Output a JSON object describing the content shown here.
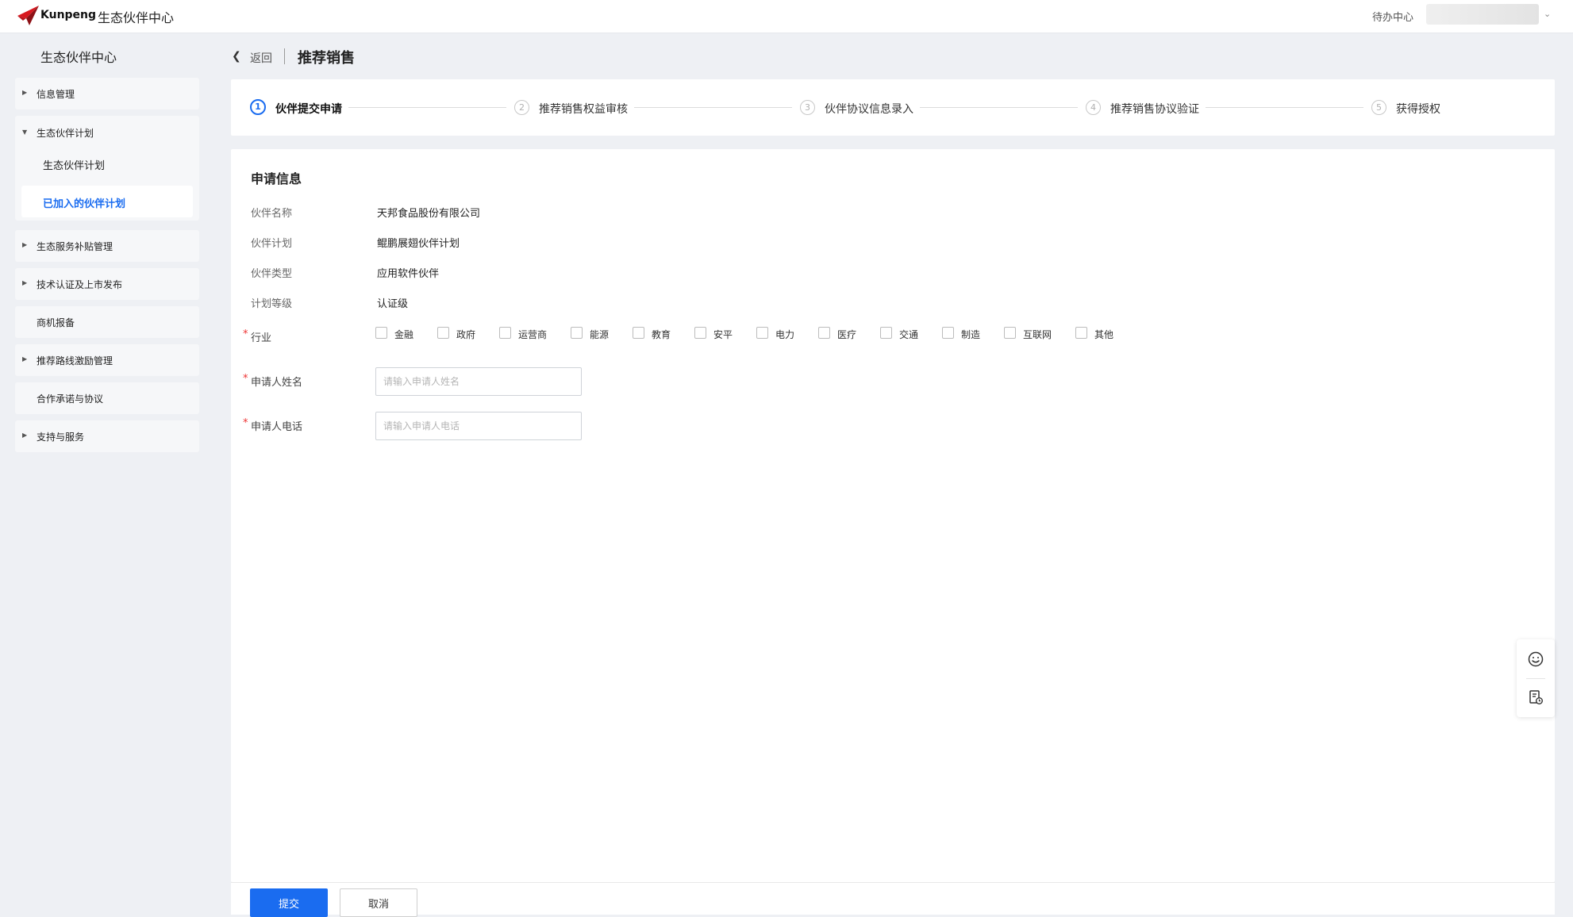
{
  "topbar": {
    "brand": "Kunpeng",
    "app_title": "生态伙伴中心",
    "todo_label": "待办中心"
  },
  "sidebar": {
    "title": "生态伙伴中心",
    "items": [
      {
        "label": "信息管理"
      },
      {
        "label": "生态伙伴计划",
        "children": [
          {
            "label": "生态伙伴计划"
          },
          {
            "label": "已加入的伙伴计划"
          }
        ]
      },
      {
        "label": "生态服务补贴管理"
      },
      {
        "label": "技术认证及上市发布"
      },
      {
        "label": "商机报备"
      },
      {
        "label": "推荐路线激励管理"
      },
      {
        "label": "合作承诺与协议"
      },
      {
        "label": "支持与服务"
      }
    ]
  },
  "header": {
    "back_label": "返回",
    "page_title": "推荐销售"
  },
  "steps": [
    {
      "num": "1",
      "label": "伙伴提交申请"
    },
    {
      "num": "2",
      "label": "推荐销售权益审核"
    },
    {
      "num": "3",
      "label": "伙伴协议信息录入"
    },
    {
      "num": "4",
      "label": "推荐销售协议验证"
    },
    {
      "num": "5",
      "label": "获得授权"
    }
  ],
  "form": {
    "section_title": "申请信息",
    "fields": [
      {
        "label": "伙伴名称",
        "value": "天邦食品股份有限公司"
      },
      {
        "label": "伙伴计划",
        "value": "鲲鹏展翅伙伴计划"
      },
      {
        "label": "伙伴类型",
        "value": "应用软件伙伴"
      },
      {
        "label": "计划等级",
        "value": "认证级"
      }
    ],
    "required_mark": "*",
    "industry_label": "行业",
    "industries": [
      "金融",
      "政府",
      "运营商",
      "能源",
      "教育",
      "安平",
      "电力",
      "医疗",
      "交通",
      "制造",
      "互联网",
      "其他"
    ],
    "name_label": "申请人姓名",
    "name_placeholder": "请输入申请人姓名",
    "phone_label": "申请人电话",
    "phone_placeholder": "请输入申请人电话"
  },
  "actions": {
    "submit_label": "提交",
    "cancel_label": "取消"
  },
  "colors": {
    "accent": "#1a6cf0",
    "required": "#ee3333"
  }
}
